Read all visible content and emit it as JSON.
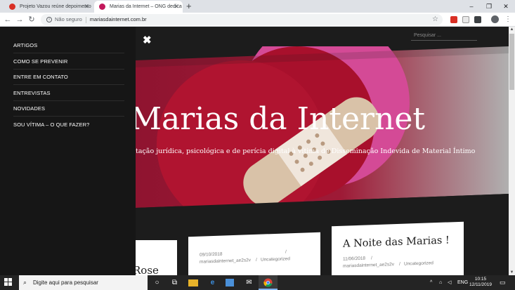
{
  "tabs": [
    {
      "title": "Projeto Vazou reúne depoimento",
      "state": "inactive"
    },
    {
      "title": "Marias da Internet – ONG dedica",
      "state": "active"
    }
  ],
  "window": {
    "minimize": "–",
    "restore": "❐",
    "close": "✕",
    "new_tab": "+",
    "tab_close": "✕"
  },
  "toolbar": {
    "back": "←",
    "forward": "→",
    "reload": "↻",
    "security_label": "Não seguro",
    "url": "mariasdainternet.com.br",
    "star": "☆",
    "menu": "⋮"
  },
  "site": {
    "close_menu": "✖",
    "search_placeholder": "Pesquisar ...",
    "nav_items": [
      "ARTIGOS",
      "COMO SE PREVENIR",
      "ENTRE EM CONTATO",
      "ENTREVISTAS",
      "NOVIDADES",
      "SOU VÍTIMA – O QUE FAZER?"
    ],
    "hero_title": "Marias da Internet",
    "hero_subtitle": "tação jurídica, psicológica e de perícia digital à vítima de Disseminação Indevida de Material Íntimo",
    "colors": {
      "heart_red": "#a8102c",
      "pink": "#d44a96",
      "bandage": "#d9c2a8",
      "page_bg": "#1c1c1c"
    }
  },
  "cards": [
    {
      "title": "Rose",
      "date": "",
      "author": "",
      "category": ""
    },
    {
      "title": "",
      "date": "09/10/2018",
      "author": "mariasdainternet_ae2s2v",
      "category": "Uncategorized"
    },
    {
      "title": "A Noite das Marias !",
      "date": "11/06/2018",
      "author": "mariasdainternet_ae2s2v",
      "category": "Uncategorized"
    }
  ],
  "meta_sep": "/",
  "taskbar": {
    "search_placeholder": "Digite aqui para pesquisar",
    "language": "ENG",
    "time": "10:15",
    "date": "12/11/2019",
    "icons": [
      "start-icon",
      "cortana-icon",
      "task-view-icon",
      "file-explorer-icon",
      "edge-icon",
      "store-icon",
      "mail-icon",
      "chrome-icon"
    ]
  }
}
